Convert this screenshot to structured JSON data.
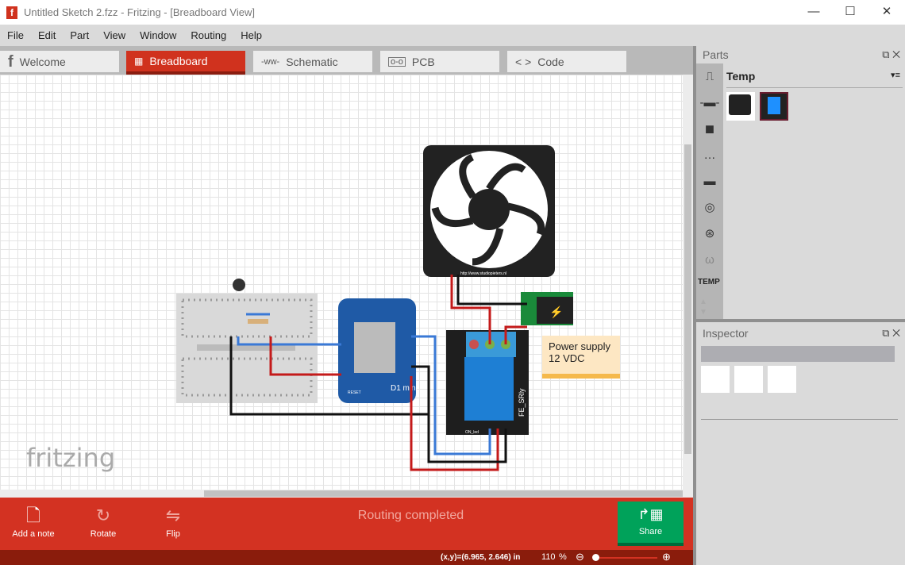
{
  "window": {
    "title": "Untitled Sketch 2.fzz - Fritzing - [Breadboard View]",
    "app_icon": "fritzing-f-icon",
    "controls": [
      "minimize",
      "maximize",
      "close"
    ]
  },
  "menu": [
    "File",
    "Edit",
    "Part",
    "View",
    "Window",
    "Routing",
    "Help"
  ],
  "tabs": [
    {
      "label": "Welcome",
      "icon": "fritzing-f-icon"
    },
    {
      "label": "Breadboard",
      "icon": "breadboard-icon",
      "active": true
    },
    {
      "label": "Schematic",
      "icon": "resistor-icon"
    },
    {
      "label": "PCB",
      "icon": "pcb-icon"
    },
    {
      "label": "Code",
      "icon": "code-icon"
    }
  ],
  "canvas": {
    "watermark": "fritzing",
    "fan_url": "http://www.studiopieters.nl",
    "board_labels": {
      "d1": "D1 mini",
      "reset": "RESET",
      "relay": "FE_SRly",
      "on_led": "ON_led"
    },
    "note": {
      "line1": "Power supply",
      "line2": "12 VDC"
    }
  },
  "toolbar": {
    "add_note": "Add a note",
    "rotate": "Rotate",
    "flip": "Flip",
    "status": "Routing completed",
    "share": "Share"
  },
  "statusbar": {
    "coords": "(x,y)=(6.965, 2.646) in",
    "zoom": "110",
    "zoom_unit": "%"
  },
  "parts": {
    "title": "Parts",
    "bin_title": "Temp",
    "bin_label": "TEMP",
    "items": [
      "fan",
      "relay-module"
    ]
  },
  "inspector": {
    "title": "Inspector"
  },
  "colors": {
    "accent": "#d33222",
    "share": "#00a25a",
    "status": "#8a1c0c"
  }
}
